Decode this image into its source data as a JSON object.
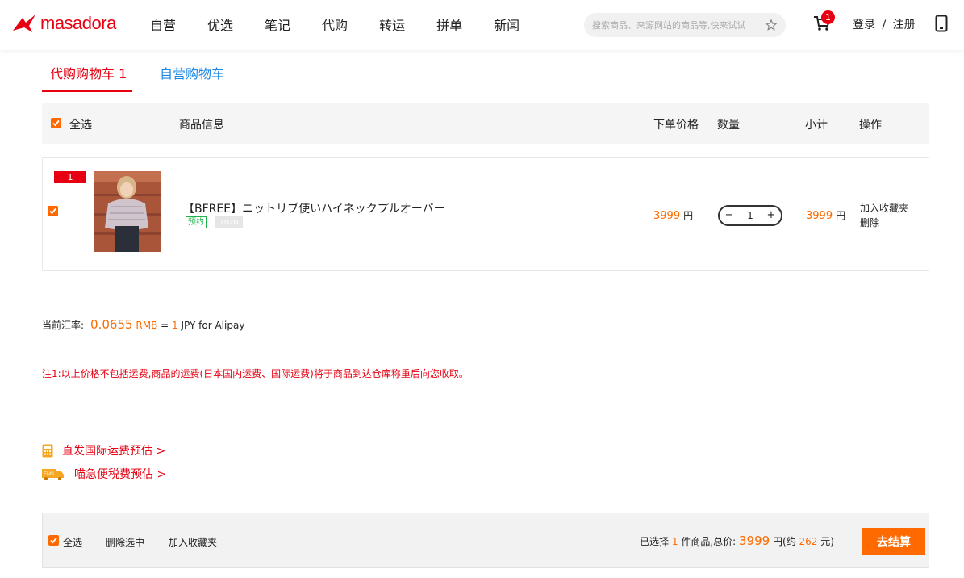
{
  "header": {
    "logo_text": "masadora",
    "nav": [
      "自营",
      "优选",
      "笔记",
      "代购",
      "转运",
      "拼单",
      "新闻"
    ],
    "search_placeholder": "搜索商品、来源网站的商品等,快来试试",
    "cart_count": "1",
    "login_label": "登录",
    "separator": "/",
    "register_label": "注册"
  },
  "tabs": {
    "active": "代购购物车 1",
    "other": "自营购物车"
  },
  "table": {
    "select_all": "全选",
    "col_info": "商品信息",
    "col_price": "下单价格",
    "col_qty": "数量",
    "col_subtotal": "小计",
    "col_ops": "操作"
  },
  "item": {
    "index": "1",
    "title": "【BFREE】ニットリブ使いハイネックプルオーバー",
    "tag_preorder": "预约",
    "tag_source": "zozo",
    "price": "3999",
    "currency": "円",
    "quantity": "1",
    "minus": "−",
    "plus": "+",
    "subtotal": "3999",
    "op_favorite": "加入收藏夹",
    "op_delete": "删除"
  },
  "rate": {
    "label": "当前汇率:",
    "value": "0.0655",
    "rmb": "RMB",
    "equals": "=",
    "one": "1",
    "jpy": "JPY for Alipay"
  },
  "note": "注1:以上价格不包括运费,商品的运费(日本国内运费、国际运费)将于商品到达仓库称重后向您收取。",
  "links": {
    "shipping": "直发国际运费预估 >",
    "tax": "喵急便税费预估 >",
    "ems_label": "EMS"
  },
  "footer": {
    "select_all": "全选",
    "delete_selected": "删除选中",
    "add_favorite": "加入收藏夹",
    "selected_prefix": "已选择",
    "selected_count": "1",
    "selected_suffix": "件商品,总价:",
    "total": "3999",
    "total_unit": "円(约",
    "rmb_value": "262",
    "rmb_unit": "元)",
    "checkout": "去结算"
  },
  "colors": {
    "brand_red": "#e60012",
    "accent_orange": "#ff6a00",
    "link_blue": "#1e88e5",
    "preorder_green": "#22b14c"
  }
}
